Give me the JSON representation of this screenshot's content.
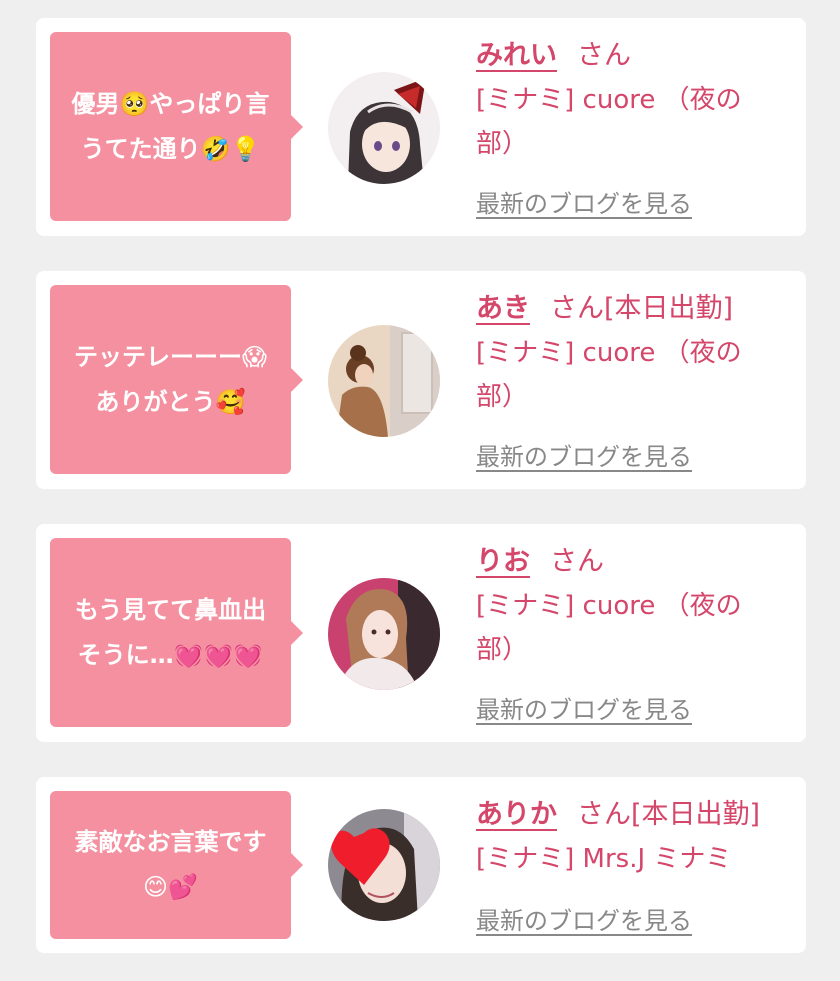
{
  "colors": {
    "background": "#efefef",
    "card": "#ffffff",
    "bubble": "#f4909f",
    "accent": "#d4466a",
    "link_gray": "#888888"
  },
  "reviews": [
    {
      "comment": "優男🥺やっぱり言\nうてた通り🤣💡",
      "name": "みれい",
      "honorific": "さん",
      "status": "",
      "shop": "[ミナミ] cuore （夜の\n部）",
      "blog_link": "最新のブログを見る",
      "avatar_icon": "anime-girl-avatar"
    },
    {
      "comment": "テッテレーーー😱\nありがとう🥰",
      "name": "あき",
      "honorific": "さん",
      "status": "[本日出勤]",
      "shop": "[ミナミ] cuore （夜の\n部）",
      "blog_link": "最新のブログを見る",
      "avatar_icon": "mirror-selfie-avatar"
    },
    {
      "comment": "もう見てて鼻血出\nそうに…💓💓💓",
      "name": "りお",
      "honorific": "さん",
      "status": "",
      "shop": "[ミナミ] cuore （夜の\n部）",
      "blog_link": "最新のブログを見る",
      "avatar_icon": "woman-portrait-avatar"
    },
    {
      "comment": "素敵なお言葉です\n😊💕",
      "name": "ありか",
      "honorific": "さん",
      "status": "[本日出勤]",
      "shop": "[ミナミ] Mrs.J ミナミ",
      "blog_link": "最新のブログを見る",
      "avatar_icon": "heart-covered-face-avatar"
    }
  ]
}
